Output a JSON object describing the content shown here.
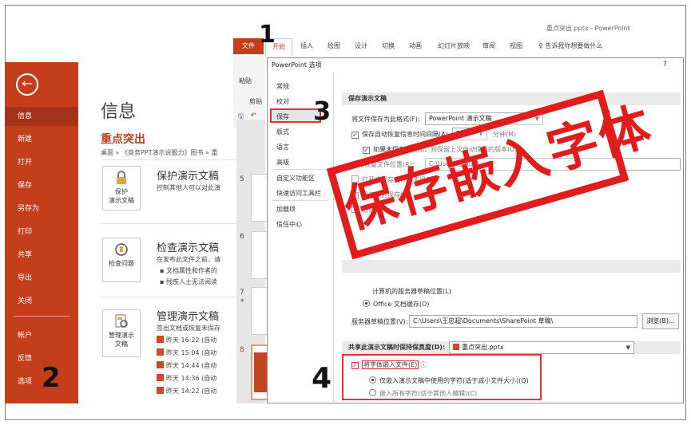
{
  "window": {
    "title": "重点突出.pptx  -  PowerPoint"
  },
  "ribbon": {
    "tabs": [
      "文件",
      "开始",
      "插入",
      "绘图",
      "设计",
      "切换",
      "动画",
      "幻灯片放映",
      "审阅",
      "视图"
    ],
    "tell_me": "告诉我你想要做什么",
    "paste": "粘贴",
    "clipboard": "剪贴"
  },
  "backstage": {
    "items": [
      "信息",
      "新建",
      "打开",
      "保存",
      "另存为",
      "打印",
      "共享",
      "导出",
      "关闭",
      "帐户",
      "反馈",
      "选项"
    ],
    "active": "信息"
  },
  "info": {
    "title": "信息",
    "doc_name": "重点突出",
    "breadcrumb": "桌面 » 《商务PPT演示说服力》图书 » 重",
    "protect": {
      "tile": "保护\n演示文稿",
      "heading": "保护演示文稿",
      "desc": "控制其他人可以对此演"
    },
    "inspect": {
      "tile": "检查问题",
      "heading": "检查演示文稿",
      "desc": "在发布此文件之前，请",
      "bullets": [
        "文档属性和作者的",
        "残疾人士无法阅读"
      ]
    },
    "manage": {
      "tile": "管理演示\n文稿",
      "heading": "管理演示文稿",
      "desc": "签出文档或恢复未保存",
      "versions": [
        "昨天 16:22 (自动",
        "昨天 15:04 (自动",
        "昨天 14:44 (自动",
        "昨天 14:36 (自动",
        "昨天 14:22 (自动"
      ]
    }
  },
  "thumbnails": [
    "5",
    "6",
    "7",
    "*",
    "8"
  ],
  "dialog": {
    "title": "PowerPoint 选项",
    "help": "?",
    "nav": [
      "常规",
      "校对",
      "保存",
      "版式",
      "语言",
      "高级",
      "自定义功能区",
      "快速访问工具栏",
      "加载项",
      "信任中心"
    ],
    "save_section": "保存演示文稿",
    "save_format_label": "将文件保存为此格式(F):",
    "save_format_value": "PowerPoint 演示文稿",
    "autorecover_label": "保存自动恢复信息时间间隔(A)",
    "autorecover_value": "10",
    "autorecover_unit": "分钟(M)",
    "keep_last_label": "如果未保存就关闭，则保留上次自动保留的版本(U)",
    "autorecover_path_label": "自动恢复文件位置(R):",
    "autorecover_path_value": "C:\\Users\\王忠超\\",
    "open_check_label": "打开或保存文件时不显示 B",
    "show_other_label": "显示其他保存位",
    "default_label": "默认",
    "server_check_label": "计算机的服务器草稿位置(L)",
    "office_cache_label": "Office 文档缓存(O)",
    "server_path_label": "服务器草稿位置(V):",
    "server_path_value": "C:\\Users\\王忠超\\Documents\\SharePoint 草稿\\",
    "browse": "浏览(B)...",
    "fidelity_label": "共享此演示文稿时保持保真度(D):",
    "fidelity_value": "重点突出.pptx",
    "embed_label": "将字体嵌入文件(E)",
    "embed_info": "ⓘ",
    "embed_opt1": "仅嵌入演示文稿中使用的字符(适于减小文件大小)(Q)",
    "embed_opt2": "嵌入所有字符(适于其他人编辑)(C)"
  },
  "stamp": "保存嵌入字体",
  "steps": [
    "1",
    "2",
    "3",
    "4"
  ],
  "colors": {
    "accent": "#c43e1c",
    "highlight": "#e03434",
    "stamp": "#e21b1b"
  }
}
